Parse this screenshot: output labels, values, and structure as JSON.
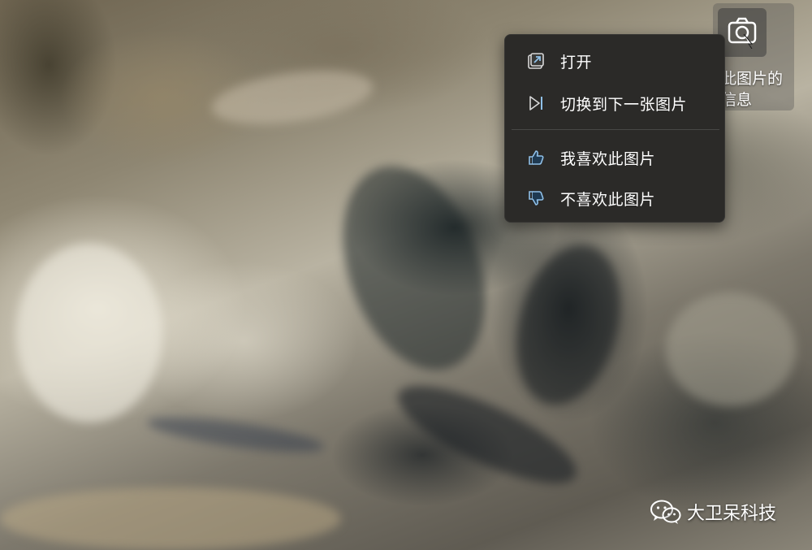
{
  "context_menu": {
    "items": [
      {
        "label": "打开",
        "icon": "open-external-icon"
      },
      {
        "label": "切换到下一张图片",
        "icon": "next-image-icon"
      },
      {
        "label": "我喜欢此图片",
        "icon": "thumbs-up-icon"
      },
      {
        "label": "不喜欢此图片",
        "icon": "thumbs-down-icon"
      }
    ]
  },
  "camera_widget": {
    "icon": "camera-lens-icon",
    "caption_line1": "此图片的",
    "caption_line2": "信息"
  },
  "watermark": {
    "icon": "wechat-icon",
    "text": "大卫呆科技"
  },
  "colors": {
    "menu_bg": "#2b2a28",
    "menu_text": "#ffffff",
    "icon_accent": "#8fc0e8"
  }
}
